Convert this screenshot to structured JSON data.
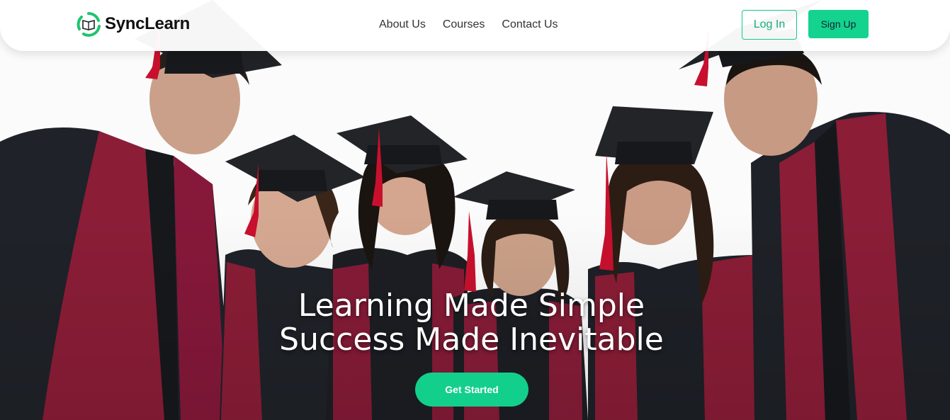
{
  "brand": {
    "name": "SyncLearn",
    "logo_icon": "book-sync-icon"
  },
  "nav": {
    "links": [
      {
        "label": "About Us"
      },
      {
        "label": "Courses"
      },
      {
        "label": "Contact Us"
      }
    ],
    "login_label": "Log In",
    "signup_label": "Sign Up"
  },
  "hero": {
    "headline_line1": "Learning Made Simple",
    "headline_line2": "Success Made Inevitable",
    "cta_label": "Get Started",
    "image_subject": "graduates-in-caps-and-gowns"
  },
  "colors": {
    "accent": "#13d38f",
    "gown": "#1d2026",
    "stole": "#8a1d36",
    "tassel": "#c8102e"
  }
}
